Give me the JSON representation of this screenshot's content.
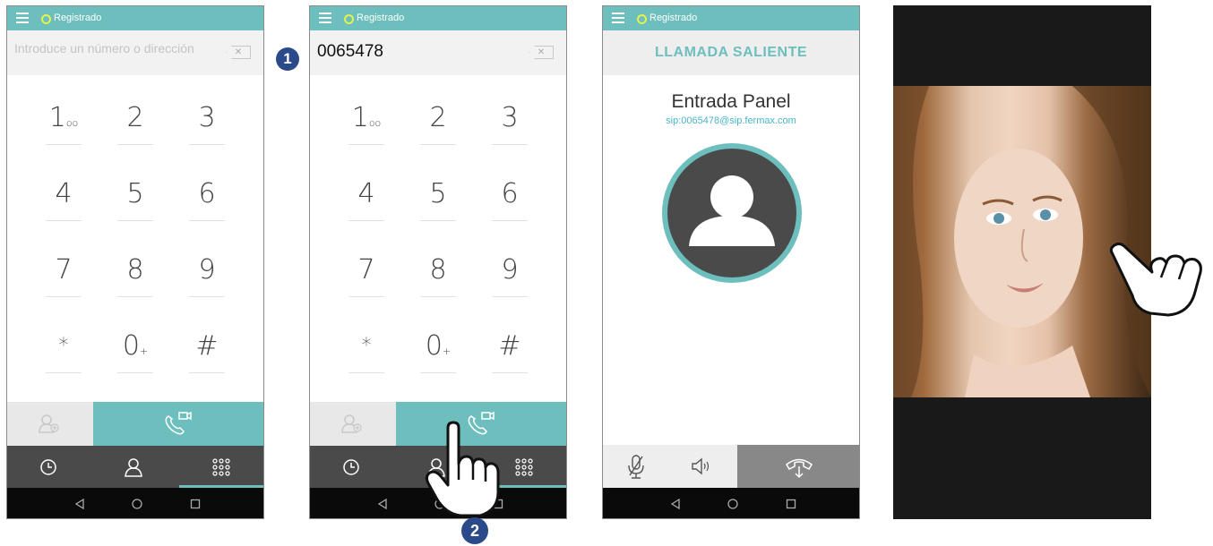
{
  "status": {
    "label": "Registrado"
  },
  "dialer": {
    "placeholder": "Introduce un número o dirección",
    "entered_number": "0065478",
    "keys": [
      {
        "digit": "1",
        "sub": "oo"
      },
      {
        "digit": "2",
        "sub": ""
      },
      {
        "digit": "3",
        "sub": ""
      },
      {
        "digit": "4",
        "sub": ""
      },
      {
        "digit": "5",
        "sub": ""
      },
      {
        "digit": "6",
        "sub": ""
      },
      {
        "digit": "7",
        "sub": ""
      },
      {
        "digit": "8",
        "sub": ""
      },
      {
        "digit": "9",
        "sub": ""
      },
      {
        "digit": "*",
        "sub": ""
      },
      {
        "digit": "0",
        "sub": "+"
      },
      {
        "digit": "#",
        "sub": ""
      }
    ]
  },
  "call": {
    "title": "LLAMADA SALIENTE",
    "name": "Entrada Panel",
    "address": "sip:0065478@sip.fermax.com"
  },
  "steps": {
    "one": "1",
    "two": "2"
  },
  "colors": {
    "accent": "#6dbfbd",
    "dark": "#4a4a4a",
    "badge": "#2a4a8a",
    "reg_dot": "#e4f24a"
  },
  "icons": {
    "menu": "hamburger-icon",
    "add_contact": "add-contact-icon",
    "video_call": "video-call-icon",
    "history": "clock-icon",
    "contacts": "person-icon",
    "dialpad": "dialpad-icon",
    "mute": "microphone-muted-icon",
    "speaker": "speaker-icon",
    "hangup": "hang-up-icon",
    "back": "back-triangle-icon",
    "home": "home-circle-icon",
    "recents": "recents-square-icon",
    "hand": "pointing-hand-icon"
  }
}
